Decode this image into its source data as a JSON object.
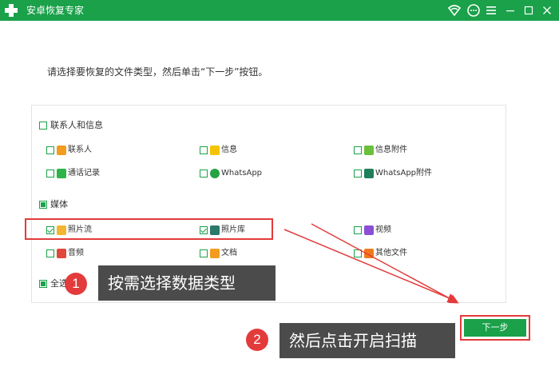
{
  "window": {
    "title": "安卓恢复专家",
    "controls": [
      {
        "name": "wifi-icon",
        "glyph": "wifi"
      },
      {
        "name": "chat-icon",
        "glyph": "chat"
      },
      {
        "name": "menu-icon",
        "glyph": "menu"
      },
      {
        "name": "minimize-icon",
        "glyph": "minimize"
      },
      {
        "name": "maximize-icon",
        "glyph": "maximize"
      },
      {
        "name": "close-icon",
        "glyph": "close"
      }
    ]
  },
  "instruction": "请选择要恢复的文件类型，然后单击“下一步”按钮。",
  "groups": {
    "contacts": {
      "label": "联系人和信息",
      "checked": false,
      "items": [
        {
          "label": "联系人",
          "icon": "contacts-icon",
          "color": "#f39c1f",
          "checked": false
        },
        {
          "label": "信息",
          "icon": "message-icon",
          "color": "#f5c400",
          "checked": false
        },
        {
          "label": "信息附件",
          "icon": "attachment-icon",
          "color": "#6bbf3a",
          "checked": false
        },
        {
          "label": "通话记录",
          "icon": "call-log-icon",
          "color": "#2fb34a",
          "checked": false
        },
        {
          "label": "WhatsApp",
          "icon": "whatsapp-icon",
          "color": "#25a244",
          "checked": false
        },
        {
          "label": "WhatsApp附件",
          "icon": "whatsapp-attachment-icon",
          "color": "#1e7f5a",
          "checked": false
        }
      ]
    },
    "media": {
      "label": "媒体",
      "checked": "partial",
      "items": [
        {
          "label": "照片流",
          "icon": "photo-stream-icon",
          "color": "#f2b630",
          "checked": true
        },
        {
          "label": "照片库",
          "icon": "photo-library-icon",
          "color": "#2a7a6a",
          "checked": true
        },
        {
          "label": "视频",
          "icon": "video-icon",
          "color": "#8b4fd6",
          "checked": false
        },
        {
          "label": "音频",
          "icon": "audio-icon",
          "color": "#e2473b",
          "checked": false
        },
        {
          "label": "文档",
          "icon": "document-icon",
          "color": "#f39c1f",
          "checked": false
        },
        {
          "label": "其他文件",
          "icon": "other-files-icon",
          "color": "#f07a1a",
          "checked": false
        }
      ]
    }
  },
  "select_all": {
    "label": "全选",
    "checked": "partial"
  },
  "next_button": "下一步",
  "callouts": [
    {
      "number": "1",
      "text": "按需选择数据类型"
    },
    {
      "number": "2",
      "text": "然后点击开启扫描"
    }
  ],
  "colors": {
    "brand": "#1aa14a",
    "annotation": "#e33b3b",
    "callout_bg": "#4b4b4b"
  }
}
